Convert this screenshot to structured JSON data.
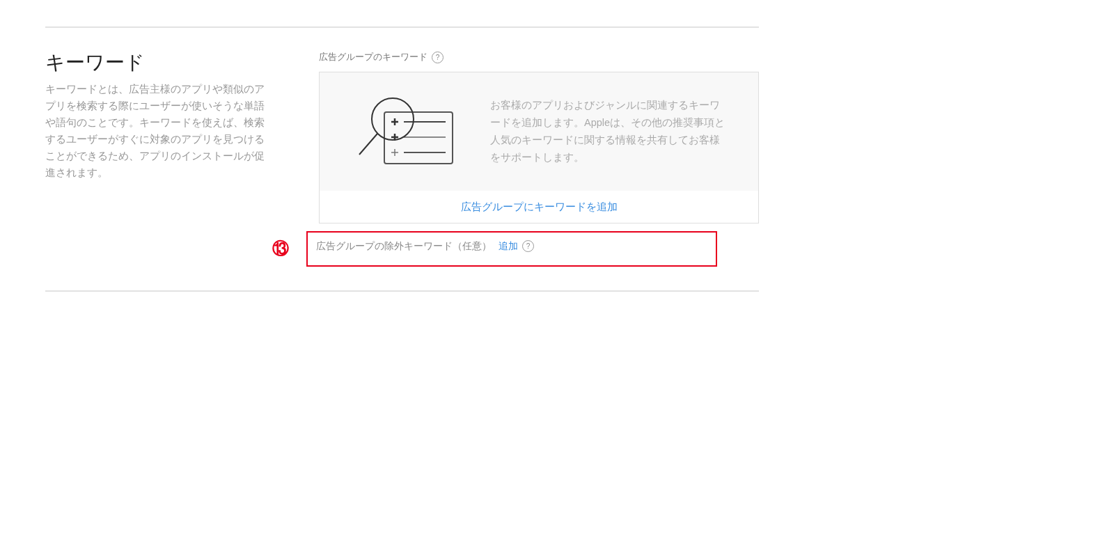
{
  "section": {
    "title": "キーワード",
    "description": "キーワードとは、広告主様のアプリや類似のアプリを検索する際にユーザーが使いそうな単語や語句のことです。キーワードを使えば、検索するユーザーがすぐに対象のアプリを見つけることができるため、アプリのインストールが促進されます。"
  },
  "keywords": {
    "label": "広告グループのキーワード",
    "help": "?",
    "empty_text": "お客様のアプリおよびジャンルに関連するキーワードを追加します。Appleは、その他の推奨事項と人気のキーワードに関する情報を共有してお客様をサポートします。",
    "add_link": "広告グループにキーワードを追加"
  },
  "negative_keywords": {
    "label": "広告グループの除外キーワード（任意）",
    "add_link": "追加",
    "help": "?"
  },
  "annotation": {
    "number": "⑬"
  }
}
